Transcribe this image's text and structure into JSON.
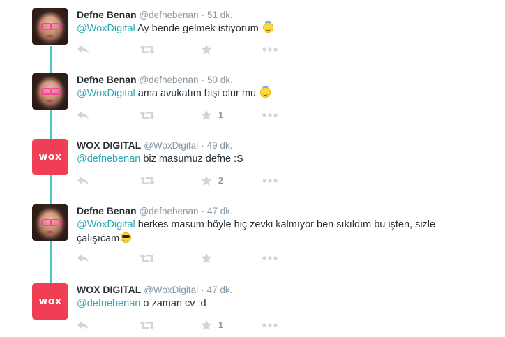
{
  "tweets": [
    {
      "name": "Defne Benan",
      "handle": "@defnebenan",
      "time": "51 dk.",
      "mention": "@WoxDigital",
      "text": " Ay bende gelmek istiyorum ",
      "emoji": "smiling-face-with-halo",
      "fav_count": "",
      "avatar": "defne"
    },
    {
      "name": "Defne Benan",
      "handle": "@defnebenan",
      "time": "50 dk.",
      "mention": "@WoxDigital",
      "text": " ama avukatım bişi olur mu ",
      "emoji": "smiling-face-with-halo",
      "fav_count": "1",
      "avatar": "defne"
    },
    {
      "name": "WOX DIGITAL",
      "handle": "@WoxDigital",
      "time": "49 dk.",
      "mention": "@defnebenan",
      "text": " biz masumuz defne :S",
      "emoji": "",
      "fav_count": "2",
      "avatar": "wox"
    },
    {
      "name": "Defne Benan",
      "handle": "@defnebenan",
      "time": "47 dk.",
      "mention": "@WoxDigital",
      "text": " herkes masum böyle hiç zevki kalmıyor ben sıkıldım bu işten, sizle çalışıcam",
      "emoji": "smiling-face-with-sunglasses",
      "fav_count": "",
      "avatar": "defne"
    },
    {
      "name": "WOX DIGITAL",
      "handle": "@WoxDigital",
      "time": "47 dk.",
      "mention": "@defnebenan",
      "text": " o zaman cv :d",
      "emoji": "",
      "fav_count": "1",
      "avatar": "wox"
    }
  ],
  "brand_logo_text": "wox",
  "separator": "·",
  "colors": {
    "mention": "#2ba8b3",
    "thread_line": "#4ec4c4",
    "brand": "#f03e54",
    "icon": "#ccd6dd",
    "meta": "#8899a6"
  }
}
